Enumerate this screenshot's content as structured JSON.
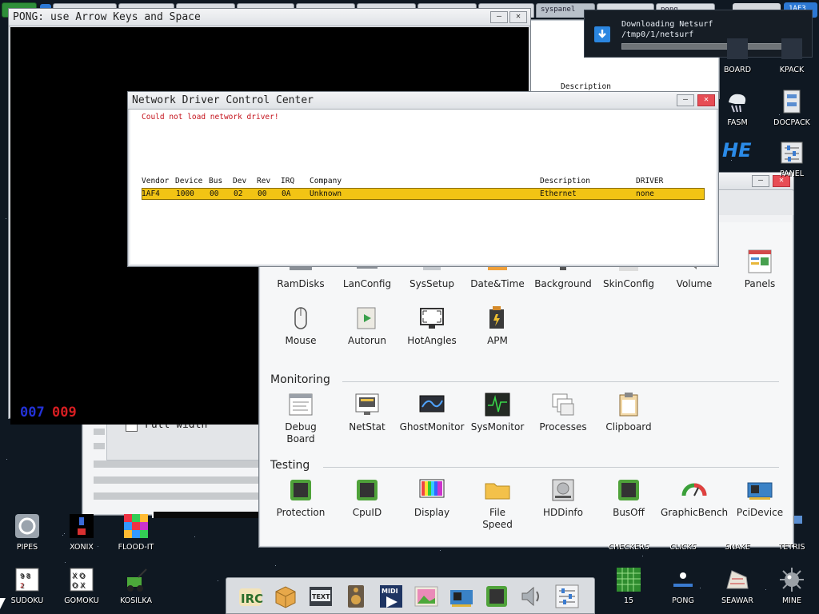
{
  "taskbar": {
    "tabs": [
      "",
      "",
      "",
      "",
      "",
      "",
      "",
      "",
      "",
      "",
      "syspanel",
      "",
      "pong",
      ""
    ],
    "tray_text": "1AF3"
  },
  "pong_window": {
    "title": "PONG: use Arrow Keys and Space",
    "score_left": "007",
    "score_right": "009",
    "behind_checkbox_label": "Full width"
  },
  "network_window": {
    "title": "Network Driver Control Center",
    "error": "Could not load network driver!",
    "columns": [
      "Vendor",
      "Device",
      "Bus",
      "Dev",
      "Rev",
      "IRQ",
      "Company",
      "Description",
      "DRIVER"
    ],
    "rows": [
      {
        "vendor": "1AF4",
        "device": "1000",
        "bus": "00",
        "dev": "02",
        "rev": "00",
        "irq": "0A",
        "company": "Unknown",
        "description": "Ethernet",
        "driver": "none"
      }
    ]
  },
  "behind_window": {
    "description_label": "Description"
  },
  "notification": {
    "title": "Downloading Netsurf",
    "path": "/tmp0/1/netsurf",
    "progress": 0
  },
  "system_panel": {
    "row1": [
      "RamDisks",
      "LanConfig",
      "SysSetup",
      "Date&Time",
      "Background",
      "SkinConfig",
      "Volume",
      "Panels"
    ],
    "row2": [
      "Mouse",
      "Autorun",
      "HotAngles",
      "APM"
    ],
    "monitoring_title": "Monitoring",
    "monitoring": [
      "Debug Board",
      "NetStat",
      "GhostMonitor",
      "SysMonitor",
      "Processes",
      "Clipboard"
    ],
    "testing_title": "Testing",
    "testing": [
      "Protection",
      "CpuID",
      "Display",
      "File Speed",
      "HDDinfo",
      "BusOff",
      "GraphicBench",
      "PciDevice"
    ]
  },
  "desktop_icons": {
    "right_top": [
      "BOARD",
      "KPACK",
      "FASM",
      "DOCPACK",
      "HE",
      "PANEL"
    ],
    "bottom_left_row1": [
      "PIPES",
      "XONIX",
      "FLOOD-IT"
    ],
    "bottom_left_row2": [
      "SUDOKU",
      "GOMOKU",
      "KOSILKA"
    ],
    "bottom_right_row1": [
      "CHECKERS",
      "CLICKS",
      "SNAKE",
      "TETRIS"
    ],
    "bottom_right_row2": [
      "15",
      "PONG",
      "SEAWAR",
      "MINE"
    ]
  },
  "dock": {
    "items": [
      "irc-icon",
      "package-icon",
      "text-icon",
      "speaker-icon",
      "midi-icon",
      "picture-icon",
      "network-card-icon",
      "chip-icon",
      "volume-icon",
      "sliders-icon"
    ],
    "irc_text": "IRC",
    "text_label": "TEXT",
    "midi_label": "MIDI"
  },
  "colors": {
    "desktop": "#0f1822",
    "highlight_row": "#f2c414",
    "error_text": "#c4131c",
    "score_left": "#2332d8",
    "score_right": "#d81e22",
    "close_button": "#e74d55"
  }
}
